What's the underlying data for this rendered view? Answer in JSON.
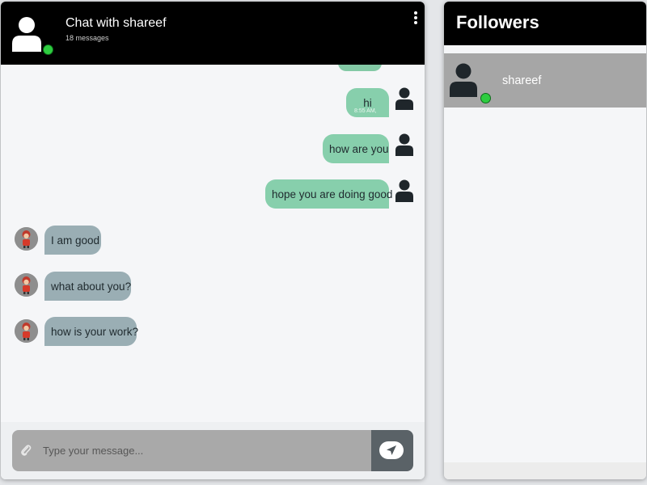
{
  "chat": {
    "title": "Chat with shareef",
    "message_count": "18 messages",
    "header_avatar_icon": "user-icon",
    "menu_icon": "kebab-menu-icon",
    "status_color": "#2ecc40"
  },
  "messages": [
    {
      "direction": "outgoing",
      "text": "hi",
      "time": "8:55 AM,"
    },
    {
      "direction": "outgoing",
      "text": "how are you",
      "time": ""
    },
    {
      "direction": "outgoing",
      "text": "hope you are doing good",
      "time": ""
    },
    {
      "direction": "incoming",
      "text": "I am good",
      "time": ""
    },
    {
      "direction": "incoming",
      "text": "what about you?",
      "time": ""
    },
    {
      "direction": "incoming",
      "text": "how is your work?",
      "time": ""
    }
  ],
  "composer": {
    "placeholder": "Type your message...",
    "attach_icon": "paperclip-icon",
    "send_icon": "send-arrow-icon"
  },
  "followers": {
    "title": "Followers",
    "items": [
      {
        "name": "shareef",
        "online": true
      }
    ]
  },
  "colors": {
    "outgoing_bubble": "#87cfac",
    "incoming_bubble": "#9aaeb4",
    "header_bg": "#000000",
    "online": "#2ecc40"
  }
}
